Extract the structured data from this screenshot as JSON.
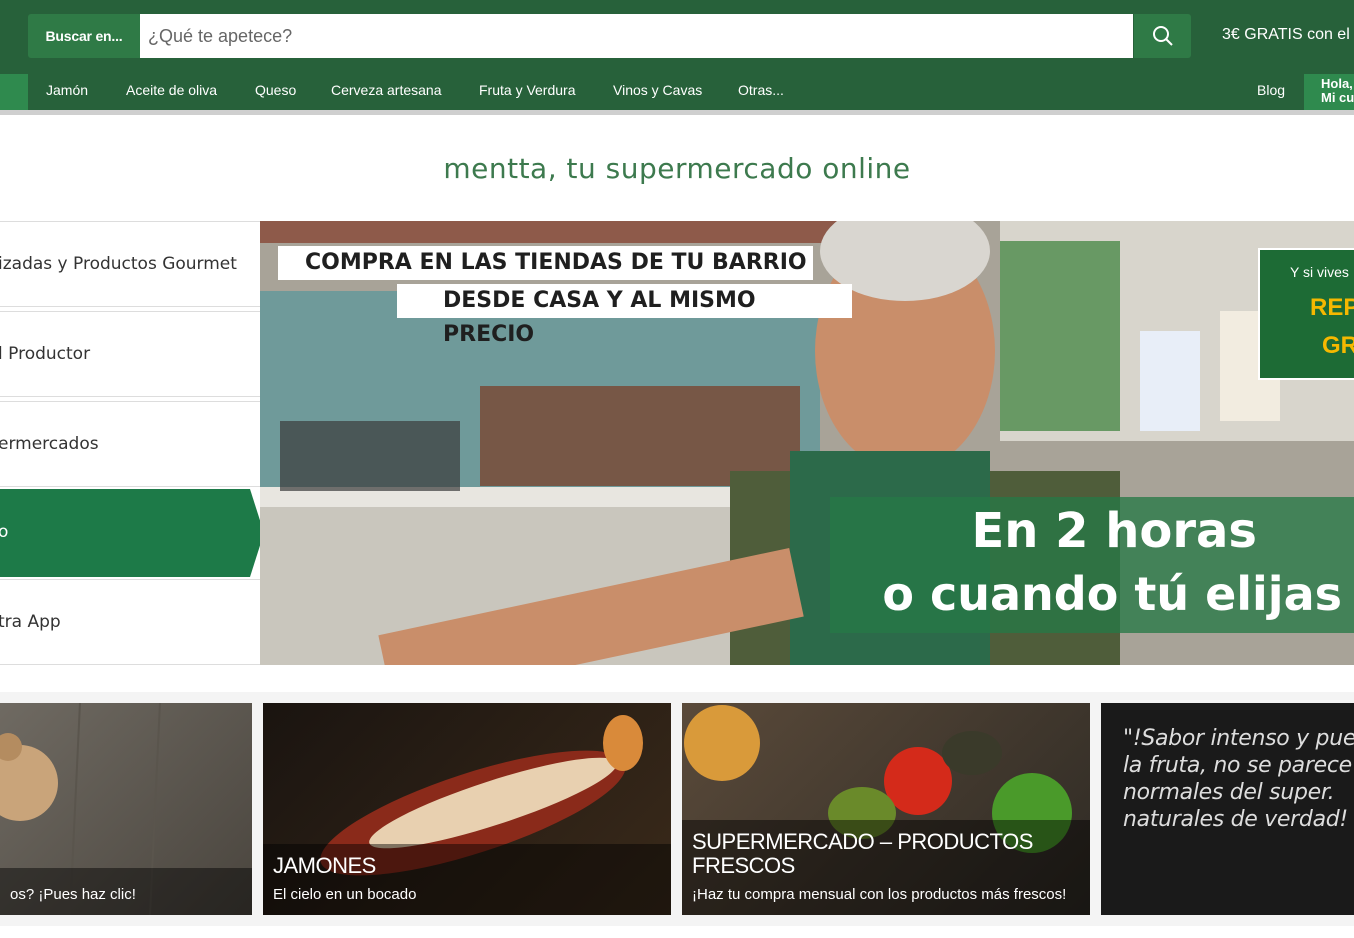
{
  "header": {
    "search": {
      "scope_label": "Buscar en...",
      "placeholder": "¿Qué te apetece?"
    },
    "promo": "3€ GRATIS con el",
    "nav": [
      "Jamón",
      "Aceite de oliva",
      "Queso",
      "Cerveza artesana",
      "Fruta y Verdura",
      "Vinos y Cavas",
      "Otras..."
    ],
    "blog": "Blog",
    "account_line1": "Hola,",
    "account_line2": "Mi cu",
    "brand_green": "#27613a"
  },
  "tagline": "mentta, tu supermercado online",
  "sidebar": {
    "items": [
      {
        "label": "izadas y Productos Gourmet"
      },
      {
        "label": "l Productor"
      },
      {
        "label": "ermercados"
      },
      {
        "label": "o"
      },
      {
        "label": "tra App"
      }
    ],
    "active_index": 3
  },
  "hero": {
    "label1": "COMPRA EN LAS TIENDAS DE TU BARRIO",
    "label2": "DESDE CASA Y AL MISMO PRECIO",
    "headline1": "En 2 horas",
    "headline2": "o cuando tú elijas",
    "box_line1": "Y si vives",
    "box_line2": "REP",
    "box_line3": "GR"
  },
  "tiles": [
    {
      "title": "",
      "subtitle": "os? ¡Pues haz clic!"
    },
    {
      "title": "JAMONES",
      "subtitle": "El cielo en un bocado"
    },
    {
      "title": "SUPERMERCADO – PRODUCTOS FRESCOS",
      "subtitle": "¡Haz tu compra mensual con los productos más frescos!"
    },
    {
      "quote_lines": [
        "\"!Sabor intenso y pue",
        "la fruta, no se parece",
        "normales del super.",
        "naturales de verdad!"
      ]
    }
  ]
}
